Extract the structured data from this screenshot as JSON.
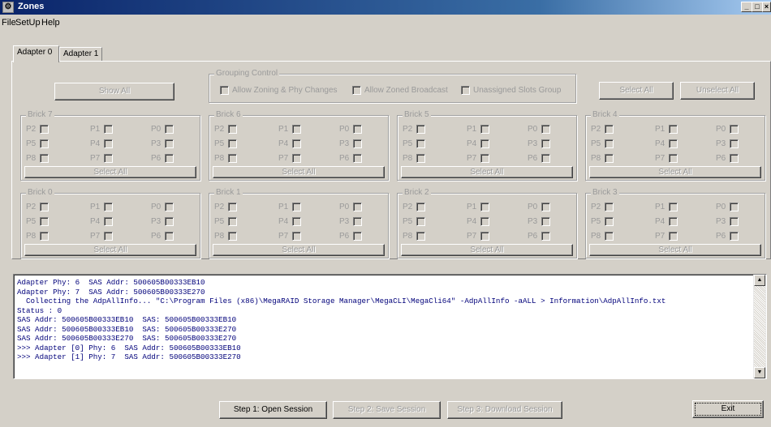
{
  "window": {
    "title": "Zones"
  },
  "menu": [
    "File",
    "SetUp",
    "Help"
  ],
  "tabs": [
    "Adapter 0",
    "Adapter 1"
  ],
  "top_controls": {
    "show_all": "Show All",
    "grouping_control": "Grouping Control",
    "allow_zoning": "Allow Zoning & Phy Changes",
    "allow_zoned_broadcast": "Allow Zoned Broadcast",
    "unassigned_slots": "Unassigned Slots Group",
    "select_all": "Select All",
    "unselect_all": "Unselect All"
  },
  "bricks": [
    {
      "title": "Brick 7",
      "select_all": "Select All",
      "phys": [
        "P2",
        "P1",
        "P0",
        "P5",
        "P4",
        "P3",
        "P8",
        "P7",
        "P6"
      ]
    },
    {
      "title": "Brick 6",
      "select_all": "Select All",
      "phys": [
        "P2",
        "P1",
        "P0",
        "P5",
        "P4",
        "P3",
        "P8",
        "P7",
        "P6"
      ]
    },
    {
      "title": "Brick 5",
      "select_all": "Select All",
      "phys": [
        "P2",
        "P1",
        "P0",
        "P5",
        "P4",
        "P3",
        "P8",
        "P7",
        "P6"
      ]
    },
    {
      "title": "Brick 4",
      "select_all": "Select All",
      "phys": [
        "P2",
        "P1",
        "P0",
        "P5",
        "P4",
        "P3",
        "P8",
        "P7",
        "P6"
      ]
    },
    {
      "title": "Brick 0",
      "select_all": "Select All",
      "phys": [
        "P2",
        "P1",
        "P0",
        "P5",
        "P4",
        "P3",
        "P8",
        "P7",
        "P6"
      ]
    },
    {
      "title": "Brick 1",
      "select_all": "Select All",
      "phys": [
        "P2",
        "P1",
        "P0",
        "P5",
        "P4",
        "P3",
        "P8",
        "P7",
        "P6"
      ]
    },
    {
      "title": "Brick 2",
      "select_all": "Select All",
      "phys": [
        "P2",
        "P1",
        "P0",
        "P5",
        "P4",
        "P3",
        "P8",
        "P7",
        "P6"
      ]
    },
    {
      "title": "Brick 3",
      "select_all": "Select All",
      "phys": [
        "P2",
        "P1",
        "P0",
        "P5",
        "P4",
        "P3",
        "P8",
        "P7",
        "P6"
      ]
    }
  ],
  "console_lines": [
    "Adapter Phy: 6  SAS Addr: 500605B00333EB10",
    "Adapter Phy: 7  SAS Addr: 500605B00333E270",
    "  Collecting the AdpAllInfo... \"C:\\Program Files (x86)\\MegaRAID Storage Manager\\MegaCLI\\MegaCli64\" -AdpAllInfo -aALL > Information\\AdpAllInfo.txt",
    "Status : 0",
    "SAS Addr: 500605B00333EB10  SAS: 500605B00333EB10",
    "SAS Addr: 500605B00333EB10  SAS: 500605B00333E270",
    "SAS Addr: 500605B00333E270  SAS: 500605B00333E270",
    ">>> Adapter [0] Phy: 6  SAS Addr: 500605B00333EB10",
    ">>> Adapter [1] Phy: 7  SAS Addr: 500605B00333E270"
  ],
  "bottom_buttons": {
    "step1": "Step 1: Open Session",
    "step2": "Step 2: Save Session",
    "step3": "Step 3: Download Session",
    "exit": "Exit"
  }
}
